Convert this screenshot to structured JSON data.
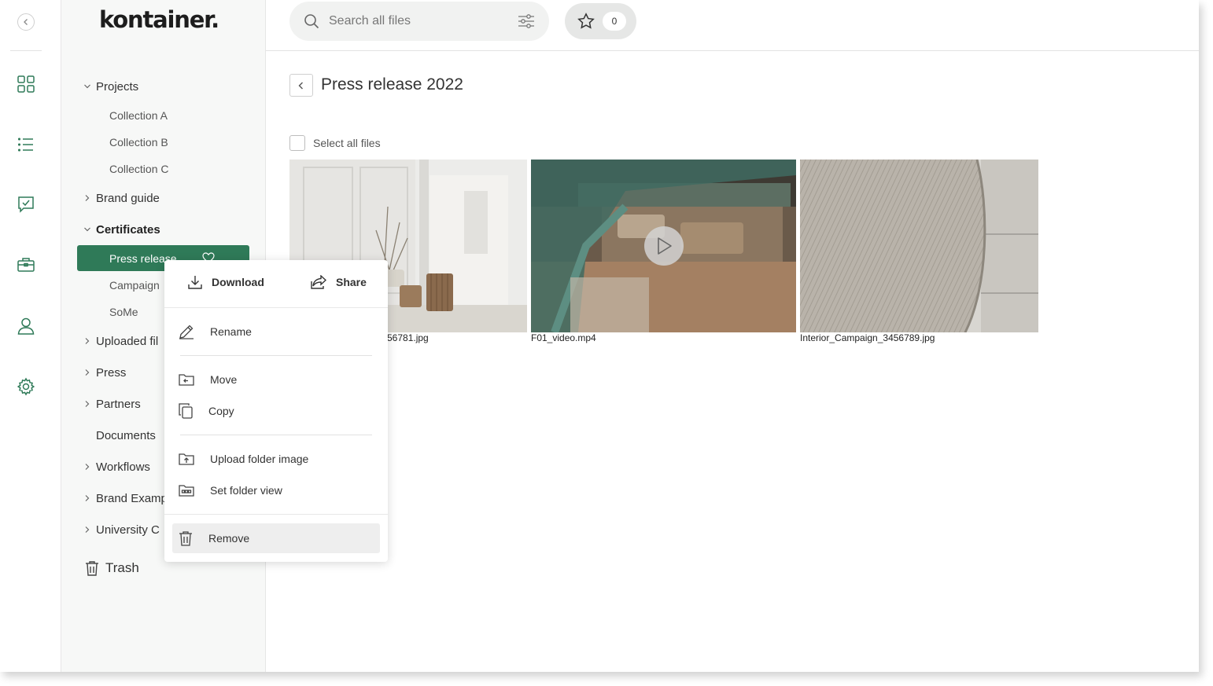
{
  "brand": {
    "logo": "kontainer.",
    "accent": "#2f7a58"
  },
  "search": {
    "placeholder": "Search all files"
  },
  "favorites": {
    "count": "0"
  },
  "sidebar": {
    "tree": [
      {
        "label": "Projects"
      },
      {
        "label": "Collection A"
      },
      {
        "label": "Collection B"
      },
      {
        "label": "Collection C"
      },
      {
        "label": "Brand guide"
      },
      {
        "label": "Certificates"
      },
      {
        "label": "Press release"
      },
      {
        "label": "Campaign"
      },
      {
        "label": "SoMe"
      },
      {
        "label": "Uploaded fil"
      },
      {
        "label": "Press"
      },
      {
        "label": "Partners"
      },
      {
        "label": "Documents"
      },
      {
        "label": "Workflows"
      },
      {
        "label": "Brand Examp"
      },
      {
        "label": "University C"
      }
    ],
    "trash": "Trash"
  },
  "main": {
    "title": "Press release 2022",
    "select_all": "Select all files",
    "files": [
      {
        "name": "56781.jpg"
      },
      {
        "name": "F01_video.mp4"
      },
      {
        "name": "Interior_Campaign_3456789.jpg"
      }
    ]
  },
  "menu": {
    "download": "Download",
    "share": "Share",
    "rename": "Rename",
    "move": "Move",
    "copy": "Copy",
    "upload_image": "Upload folder image",
    "set_view": "Set folder view",
    "remove": "Remove"
  }
}
